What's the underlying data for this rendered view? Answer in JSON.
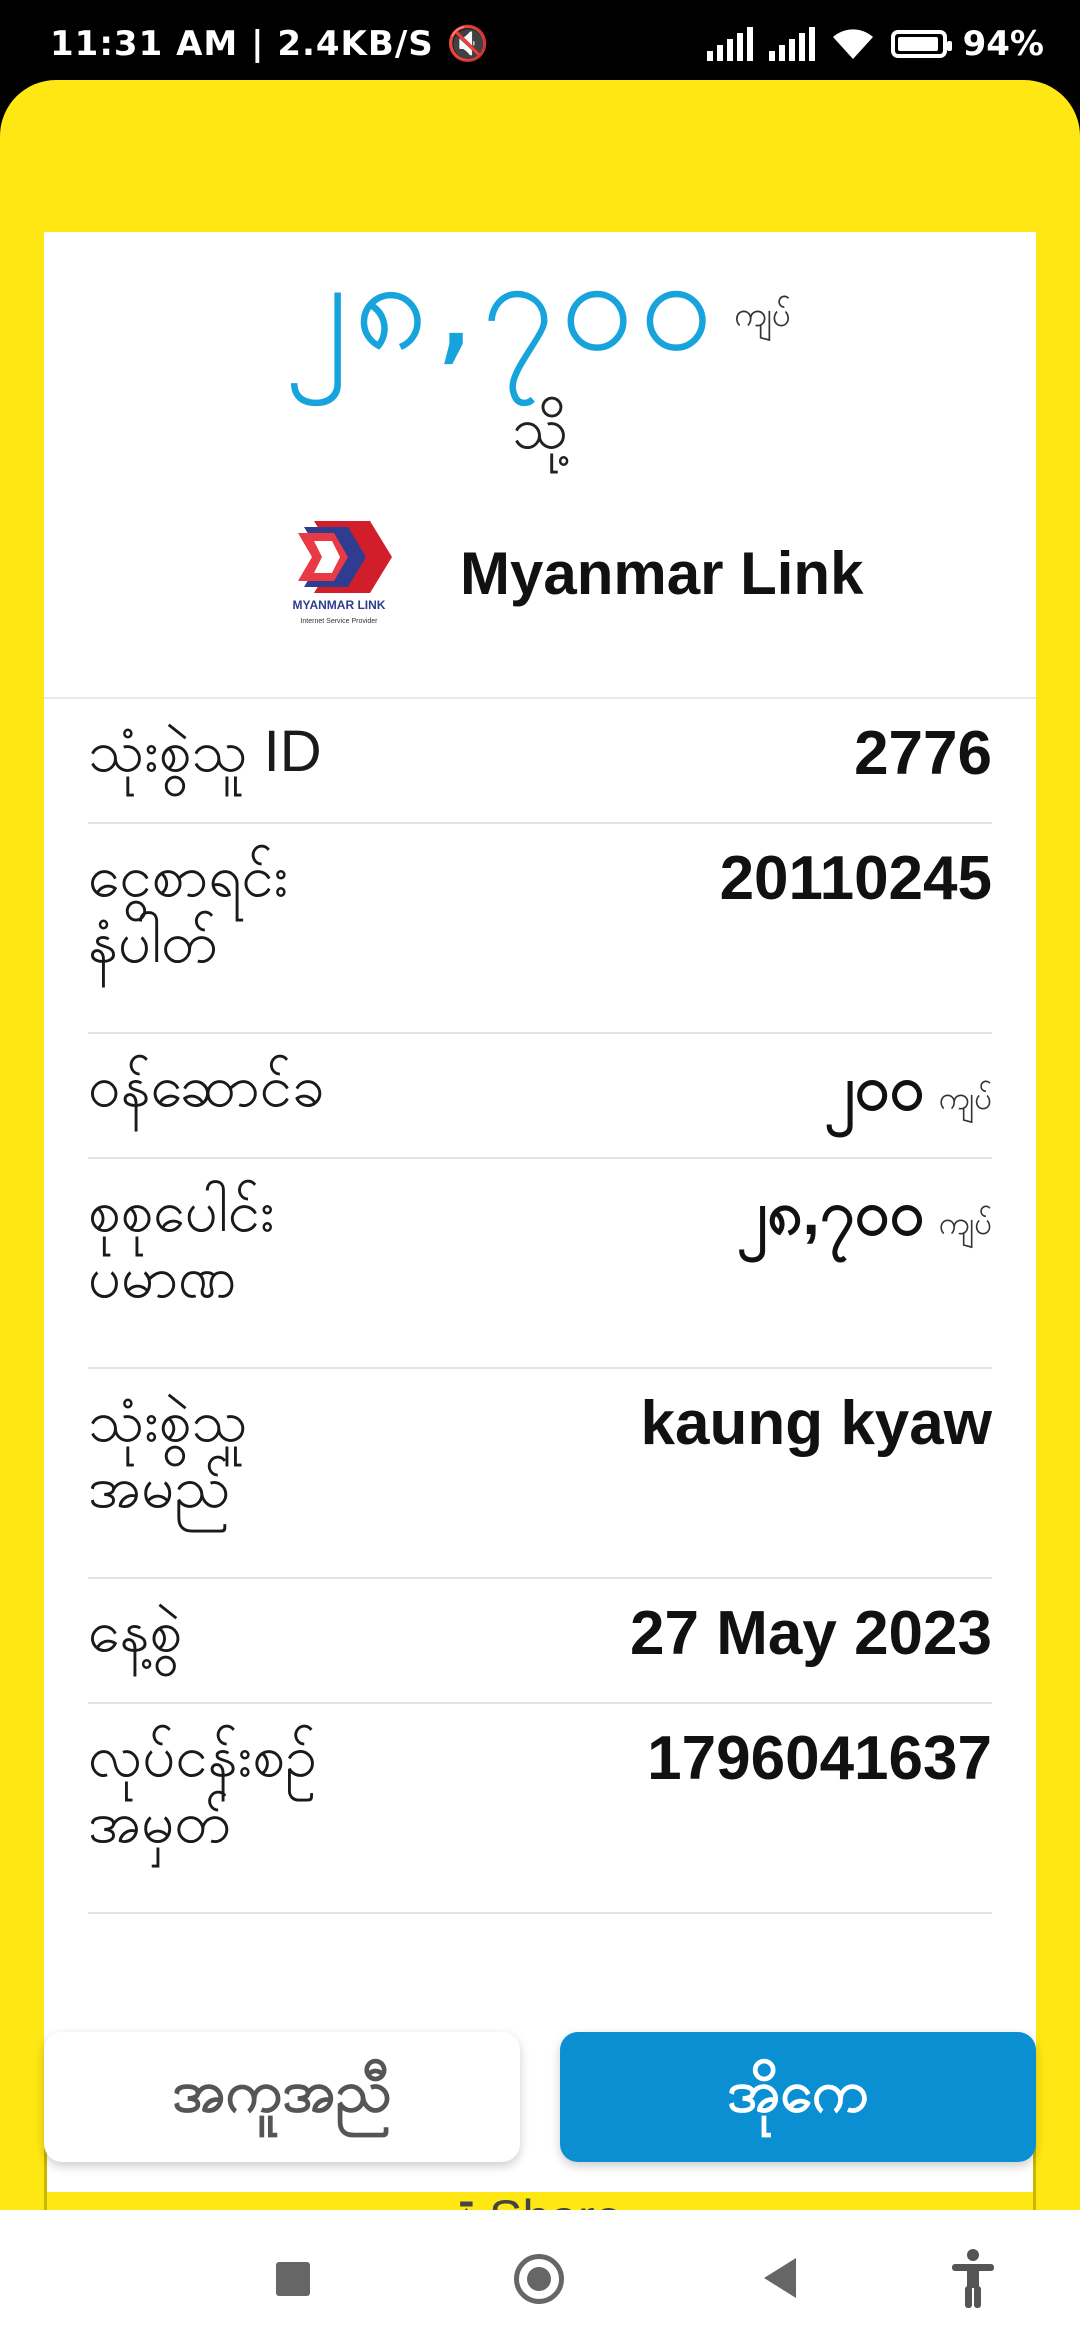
{
  "status_bar": {
    "time": "11:31 AM",
    "speed": "2.4KB/S",
    "battery": "94"
  },
  "receipt": {
    "amount": "၂၈,၇၀၀",
    "amount_unit": "ကျပ်",
    "to_label": "သို့",
    "merchant_name": "Myanmar Link",
    "logo_text": "MYANMAR LINK",
    "logo_subtext": "Internet Service Provider"
  },
  "rows": [
    {
      "label": "သုံးစွဲသူ ID",
      "value": "2776",
      "unit": ""
    },
    {
      "label": "ငွေစာရင်း\nနံပါတ်",
      "value": "20110245",
      "unit": ""
    },
    {
      "label": "ဝန်ဆောင်ခ",
      "value": "၂၀၀",
      "unit": "ကျပ်"
    },
    {
      "label": "စုစုပေါင်း\nပမာဏ",
      "value": "၂၈,၇၀၀",
      "unit": "ကျပ်"
    },
    {
      "label": "သုံးစွဲသူ\nအမည်",
      "value": "kaung kyaw",
      "unit": ""
    },
    {
      "label": "နေ့စွဲ",
      "value": "27 May 2023",
      "unit": ""
    },
    {
      "label": "လုပ်ငန်းစဉ်\nအမှတ်",
      "value": "1796041637",
      "unit": ""
    }
  ],
  "buttons": {
    "help": "အကူအညီ",
    "ok": "အိုကေ",
    "share": "Share"
  },
  "icons": {
    "share": "share-icon",
    "nav_recent": "square-icon",
    "nav_home": "home-circle-icon",
    "nav_back": "back-triangle-icon",
    "nav_access": "accessibility-icon"
  },
  "colors": {
    "accent_yellow": "#FFE714",
    "amount_blue": "#17A4DD",
    "ok_button": "#0B8FD3"
  }
}
